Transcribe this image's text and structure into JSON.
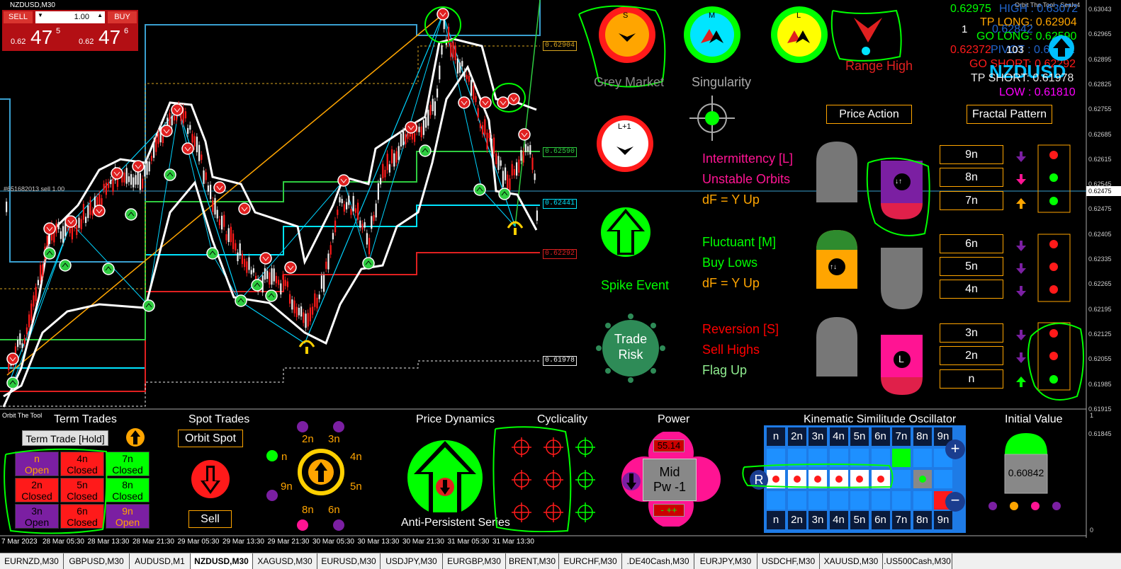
{
  "window": {
    "symbol_title": "NZDUSD,M30",
    "indicator_title": "Orbit The Tool - SeaIv4"
  },
  "trade_panel": {
    "sell_label": "SELL",
    "buy_label": "BUY",
    "lot": "1.00",
    "sell_prefix": "0.62",
    "sell_big": "47",
    "sell_small": "5",
    "buy_prefix": "0.62",
    "buy_big": "47",
    "buy_small": "6"
  },
  "order_line_label": "#651682013 sell 1.00",
  "price_axis": [
    "0.63043",
    "0.62965",
    "0.62895",
    "0.62825",
    "0.62755",
    "0.62685",
    "0.62615",
    "0.62545",
    "0.62475",
    "0.62405",
    "0.62335",
    "0.62265",
    "0.62195",
    "0.62125",
    "0.62055",
    "0.61985",
    "0.61915",
    "0.61845"
  ],
  "current_price_tag": "0.62475",
  "level_tags": {
    "tp_long": "0.62904",
    "go_long": "0.62590",
    "pivot": "0.62441",
    "go_short": "0.62292",
    "tp_short": "0.61978"
  },
  "top_right": {
    "line1_green": "0.62975",
    "line1_overlay": "HIGH : 0.63072",
    "tp_long": "TP LONG: 0.62904",
    "line3_white": "1",
    "line3_overlay": "0.62842",
    "go_long": "GO LONG: 0.62590",
    "line5_red": "0.62372",
    "pivot": "PIVOT : 0.62441",
    "line5_num": "103",
    "go_short": "GO SHORT: 0.62292",
    "symbol": "NZDUSD",
    "tp_short": "TP SHORT: 0.61978",
    "low": "LOW : 0.61810"
  },
  "circles": {
    "s": "S",
    "m": "M",
    "l": "L",
    "l1": "L+1"
  },
  "labels": {
    "grey_market": "Grey Market",
    "singularity": "Singularity",
    "range_high": "Range High",
    "spike_event": "Spike Event",
    "trade_risk": "Trade Risk",
    "price_action": "Price Action",
    "fractal_pattern": "Fractal Pattern"
  },
  "regimes": [
    {
      "title": "Intermittency [L]",
      "sub": "Unstable Orbits",
      "df": "dF = Y Up",
      "title_color": "#ff1493",
      "sub_color": "#ff1493",
      "df_color": "#ffa500"
    },
    {
      "title": "Fluctuant [M]",
      "sub": "Buy Lows",
      "df": "dF = Y Up",
      "title_color": "#00ff00",
      "sub_color": "#00ff00",
      "df_color": "#ffa500"
    },
    {
      "title": "Reversion [S]",
      "sub": "Sell Highs",
      "df": "Flag Up",
      "title_color": "#ff0000",
      "sub_color": "#ff0000",
      "df_color": "#90ee90"
    }
  ],
  "n_boxes": [
    "9n",
    "8n",
    "7n",
    "6n",
    "5n",
    "4n",
    "3n",
    "2n",
    "n"
  ],
  "bottom": {
    "orbit_label": "Orbit The Tool",
    "term_trades": "Term Trades",
    "term_trade_btn": "Term Trade [Hold]",
    "term_grid": [
      [
        "n",
        "Open"
      ],
      [
        "4n",
        "Closed"
      ],
      [
        "7n",
        "Closed"
      ],
      [
        "2n",
        "Closed"
      ],
      [
        "5n",
        "Closed"
      ],
      [
        "8n",
        "Closed"
      ],
      [
        "3n",
        "Open"
      ],
      [
        "6n",
        "Closed"
      ],
      [
        "9n",
        "Open"
      ]
    ],
    "spot_trades": "Spot Trades",
    "orbit_spot": "Orbit Spot",
    "sell": "Sell",
    "orbit_labels": [
      "n",
      "2n",
      "3n",
      "4n",
      "5n",
      "6n",
      "8n",
      "9n"
    ],
    "price_dynamics": "Price Dynamics",
    "anti_persistent": "Anti-Persistent Series",
    "cyclicality": "Cyclicality",
    "power": "Power",
    "power_value": "55.14",
    "power_mid": "Mid",
    "power_pw": "Pw -1",
    "power_bottom": "- ++",
    "kso": "Kinematic Similitude Oscillator",
    "kso_headers": [
      "n",
      "2n",
      "3n",
      "4n",
      "5n",
      "6n",
      "7n",
      "8n",
      "9n"
    ],
    "kso_r": "R",
    "initial_value": "Initial Value",
    "initial_value_num": "0.60842",
    "sub_axis_top": "1",
    "sub_axis_bottom": "0"
  },
  "time_axis": [
    "7 Mar 2023",
    "28 Mar 05:30",
    "28 Mar 13:30",
    "28 Mar 21:30",
    "29 Mar 05:30",
    "29 Mar 13:30",
    "29 Mar 21:30",
    "30 Mar 05:30",
    "30 Mar 13:30",
    "30 Mar 21:30",
    "31 Mar 05:30",
    "31 Mar 13:30"
  ],
  "tabs": [
    "EURNZD,M30",
    "GBPUSD,M30",
    "AUDUSD,M1",
    "NZDUSD,M30",
    "XAGUSD,M30",
    "EURUSD,M30",
    "USDJPY,M30",
    "EURGBP,M30",
    "BRENT,M30",
    "EURCHF,M30",
    ".DE40Cash,M30",
    "EURJPY,M30",
    "USDCHF,M30",
    "XAUUSD,M30",
    ".US500Cash,M30"
  ],
  "active_tab": "NZDUSD,M30",
  "colors": {
    "sell": "#c0151b",
    "buy": "#c0151b",
    "green": "#00ff00",
    "orange": "#ffa500",
    "magenta": "#ff1493",
    "purple": "#7b1fa2"
  }
}
